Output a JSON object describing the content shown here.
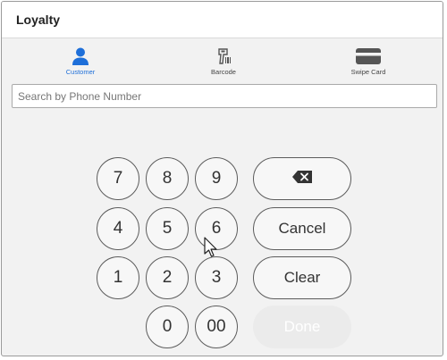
{
  "window": {
    "title": "Loyalty"
  },
  "tabs": [
    {
      "label": "Customer",
      "icon": "person-icon",
      "active": true
    },
    {
      "label": "Barcode",
      "icon": "barcode-scanner-icon",
      "active": false
    },
    {
      "label": "Swipe Card",
      "icon": "credit-card-icon",
      "active": false
    }
  ],
  "search": {
    "placeholder": "Search by Phone Number",
    "value": ""
  },
  "keypad": {
    "keys": [
      "7",
      "8",
      "9",
      "4",
      "5",
      "6",
      "1",
      "2",
      "3",
      "0",
      "00"
    ],
    "backspace_icon": "backspace-icon",
    "cancel_label": "Cancel",
    "clear_label": "Clear",
    "done_label": "Done",
    "done_enabled": false
  },
  "colors": {
    "accent": "#1e6fd9",
    "background": "#f2f2f2",
    "key_border": "#5c5c5c"
  }
}
